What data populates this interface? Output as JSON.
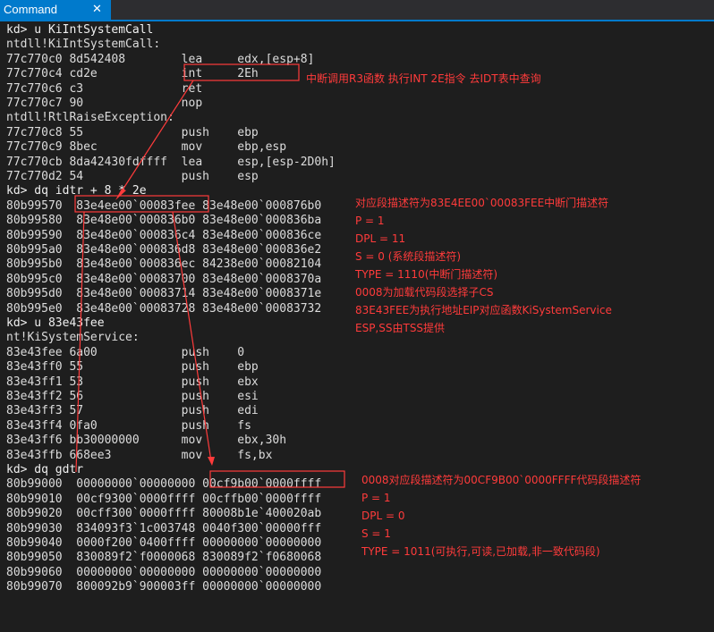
{
  "tab": {
    "title": "Command",
    "close": "✕"
  },
  "lines": [
    "kd> u KiIntSystemCall",
    "ntdll!KiIntSystemCall:",
    "77c770c0 8d542408        lea     edx,[esp+8]",
    "77c770c4 cd2e            int     2Eh",
    "77c770c6 c3              ret",
    "77c770c7 90              nop",
    "ntdll!RtlRaiseException:",
    "77c770c8 55              push    ebp",
    "77c770c9 8bec            mov     ebp,esp",
    "77c770cb 8da42430fdffff  lea     esp,[esp-2D0h]",
    "77c770d2 54              push    esp",
    "kd> dq idtr + 8 * 2e",
    "80b99570  83e4ee00`00083fee 83e48e00`000876b0",
    "80b99580  83e48e00`000836b0 83e48e00`000836ba",
    "80b99590  83e48e00`000836c4 83e48e00`000836ce",
    "80b995a0  83e48e00`000836d8 83e48e00`000836e2",
    "80b995b0  83e48e00`000836ec 84238e00`00082104",
    "80b995c0  83e48e00`00083700 83e48e00`0008370a",
    "80b995d0  83e48e00`00083714 83e48e00`0008371e",
    "80b995e0  83e48e00`00083728 83e48e00`00083732",
    "kd> u 83e43fee",
    "nt!KiSystemService:",
    "83e43fee 6a00            push    0",
    "83e43ff0 55              push    ebp",
    "83e43ff1 53              push    ebx",
    "83e43ff2 56              push    esi",
    "83e43ff3 57              push    edi",
    "83e43ff4 0fa0            push    fs",
    "83e43ff6 bb30000000      mov     ebx,30h",
    "83e43ffb 668ee3          mov     fs,bx",
    "kd> dq gdtr",
    "80b99000  00000000`00000000 00cf9b00`0000ffff",
    "80b99010  00cf9300`0000ffff 00cffb00`0000ffff",
    "80b99020  00cff300`0000ffff 80008b1e`400020ab",
    "80b99030  834093f3`1c003748 0040f300`00000fff",
    "80b99040  0000f200`0400ffff 00000000`00000000",
    "80b99050  830089f2`f0000068 830089f2`f0680068",
    "80b99060  00000000`00000000 00000000`00000000",
    "80b99070  800092b9`900003ff 00000000`00000000"
  ],
  "notes": {
    "int": "中断调用R3函数 执行INT 2E指令 去IDT表中查询",
    "idt": [
      "对应段描述符为83E4EE00`00083FEE中断门描述符",
      "P = 1",
      "DPL = 11",
      "S = 0 (系统段描述符)",
      "TYPE = 1110(中断门描述符)",
      "0008为加载代码段选择子CS",
      "83E43FEE为执行地址EIP对应函数KiSystemService",
      "ESP,SS由TSS提供"
    ],
    "gdt": [
      "0008对应段描述符为00CF9B00`0000FFFF代码段描述符",
      "P = 1",
      "DPL = 0",
      "S = 1",
      "TYPE = 1011(可执行,可读,已加载,非一致代码段)"
    ]
  },
  "annotation_color": "#ff3b3b"
}
